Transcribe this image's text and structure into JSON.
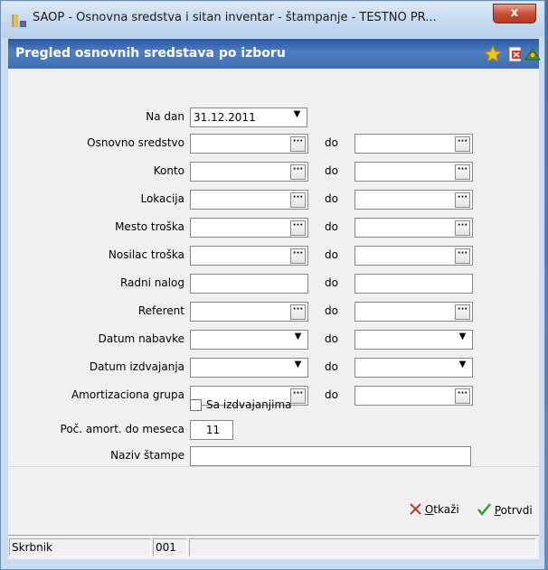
{
  "window": {
    "title": "SAOP -  Osnovna sredstva i sitan inventar - štampanje  - TESTNO PR...",
    "close_label": "x"
  },
  "header": {
    "title": "Pregled osnovnih sredstava po izboru",
    "icons": [
      "star-icon",
      "pdf-icon",
      "exit-icon"
    ]
  },
  "form": {
    "na_dan": {
      "label": "Na dan",
      "value": "31.12.2011"
    },
    "do_label": "do",
    "range_rows": [
      {
        "label": "Osnovno sredstvo",
        "type": "browse"
      },
      {
        "label": "Konto",
        "type": "browse"
      },
      {
        "label": "Lokacija",
        "type": "browse"
      },
      {
        "label": "Mesto troška",
        "type": "browse"
      },
      {
        "label": "Nosilac troška",
        "type": "browse"
      },
      {
        "label": "Radni nalog",
        "type": "text"
      },
      {
        "label": "Referent",
        "type": "browse"
      },
      {
        "label": "Datum nabavke",
        "type": "dropdown"
      },
      {
        "label": "Datum izdvajanja",
        "type": "dropdown"
      },
      {
        "label": "Amortizaciona grupa",
        "type": "browse"
      }
    ],
    "sa_izdvajanjima": {
      "label": "Sa izdvajanjima",
      "checked": false
    },
    "poc_amort": {
      "label": "Poč. amort. do meseca",
      "value": "11"
    },
    "naziv_stampe": {
      "label": "Naziv štampe",
      "value": ""
    }
  },
  "actions": {
    "cancel": {
      "underlined": "O",
      "rest": "tkaži"
    },
    "confirm": {
      "underlined": "P",
      "rest": "otrvdi"
    }
  },
  "status": {
    "user": "Skrbnik",
    "code": "001"
  },
  "colors": {
    "header_blue": "#3d6db3",
    "cancel_red": "#c0392b",
    "confirm_green": "#2e9e2e"
  }
}
